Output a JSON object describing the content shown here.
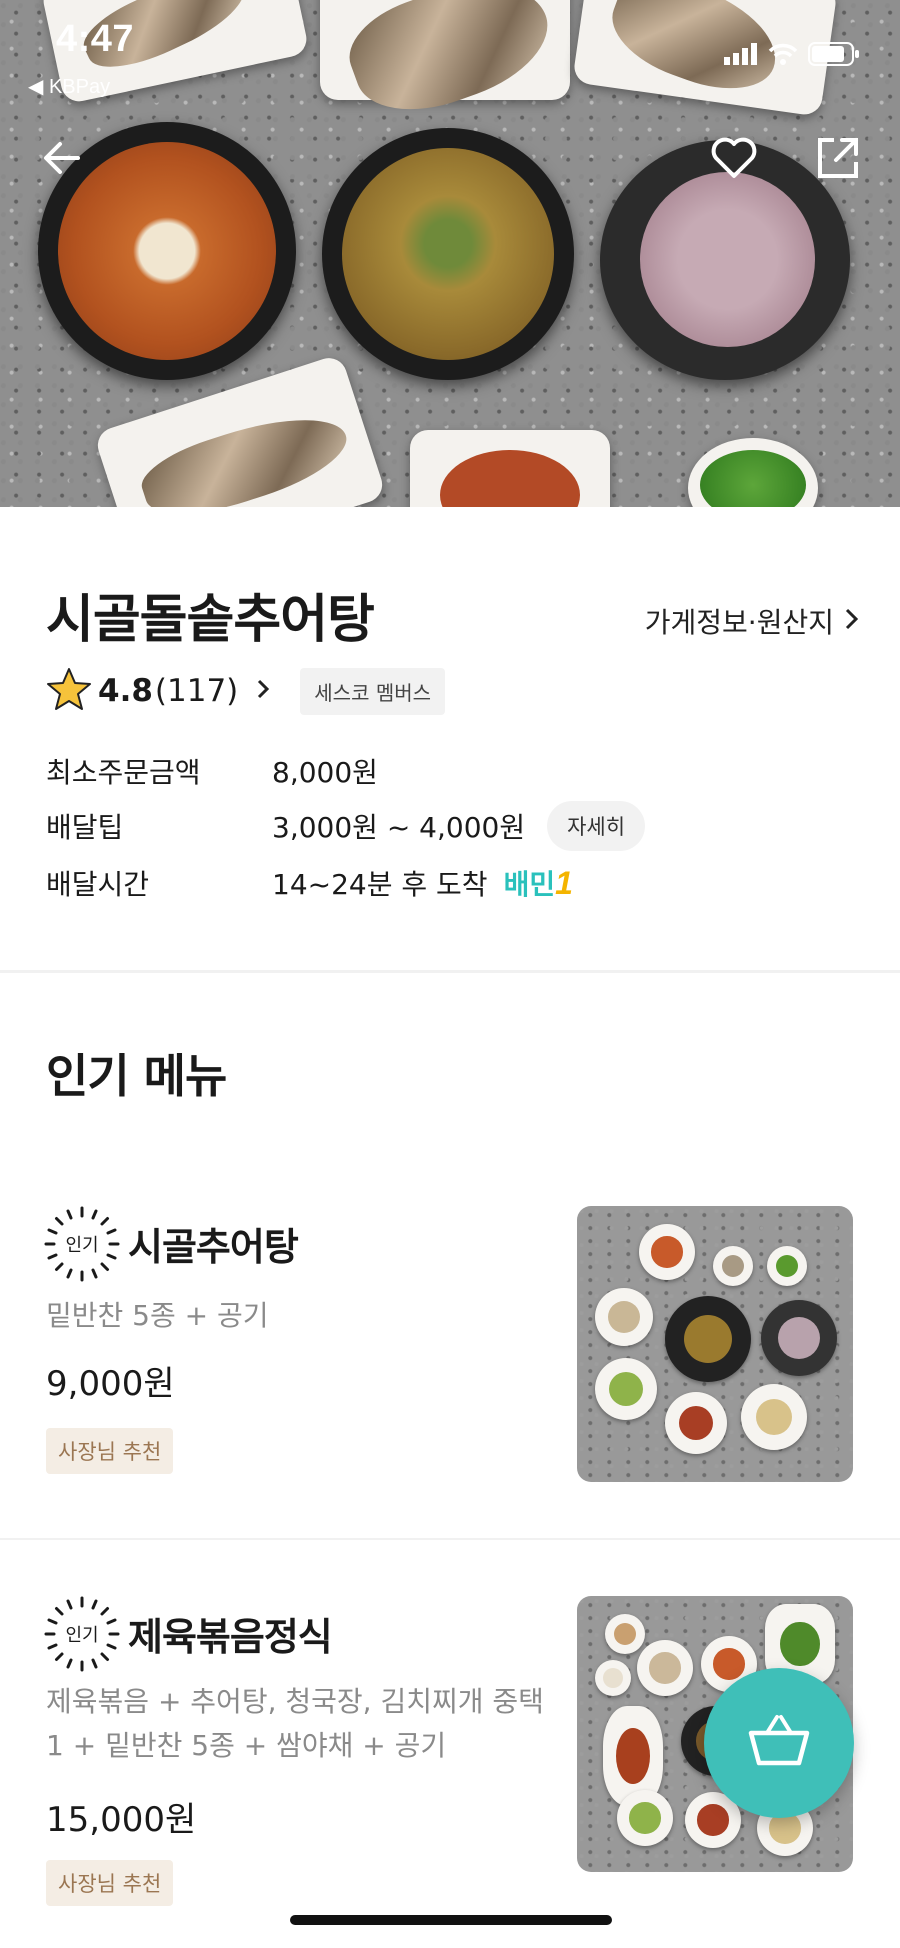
{
  "status_bar": {
    "time": "4:47",
    "back_app": "◀ KBPay"
  },
  "store": {
    "name": "시골돌솥추어탕",
    "info_link": "가게정보·원산지",
    "rating": "4.8",
    "review_count": "(117)",
    "member_badge": "세스코 멤버스",
    "rows": [
      {
        "label": "최소주문금액",
        "value": "8,000원"
      },
      {
        "label": "배달팁",
        "value": "3,000원 ~ 4,000원",
        "button": "자세히"
      },
      {
        "label": "배달시간",
        "value": "14~24분 후 도착",
        "badge_text": "배민",
        "badge_num": "1"
      }
    ]
  },
  "popular": {
    "title": "인기 메뉴",
    "badge": "인기",
    "items": [
      {
        "name": "시골추어탕",
        "desc": "밑반찬 5종 + 공기",
        "price": "9,000원",
        "tag": "사장님 추천"
      },
      {
        "name": "제육볶음정식",
        "desc": "제육볶음 + 추어탕, 청국장, 김치찌개 중택 1 + 밑반찬 5종 + 쌈야채 + 공기",
        "price": "15,000원",
        "tag": "사장님 추천"
      }
    ]
  },
  "colors": {
    "accent": "#2ac1bc",
    "fab": "#3fbfb8",
    "tag_bg": "#f4ede4",
    "tag_text": "#9b7652",
    "star": "#f6c33b"
  },
  "icons": [
    "back-arrow-icon",
    "heart-icon",
    "share-icon",
    "star-icon",
    "chevron-right-icon",
    "cart-icon",
    "signal-icon",
    "wifi-icon",
    "battery-icon"
  ]
}
